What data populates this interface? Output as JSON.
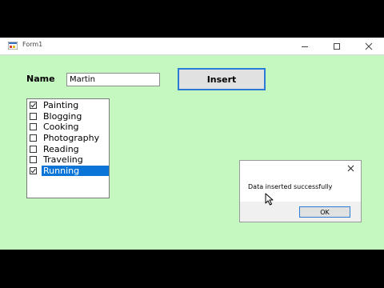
{
  "window": {
    "title": "Form1",
    "background": "#c5f7c0"
  },
  "form": {
    "name_label": "Name",
    "name_value": "Martin",
    "insert_label": "Insert"
  },
  "hobbies": [
    {
      "label": "Painting",
      "checked": true,
      "selected": false
    },
    {
      "label": "Blogging",
      "checked": false,
      "selected": false
    },
    {
      "label": "Cooking",
      "checked": false,
      "selected": false
    },
    {
      "label": "Photography",
      "checked": false,
      "selected": false
    },
    {
      "label": "Reading",
      "checked": false,
      "selected": false
    },
    {
      "label": "Traveling",
      "checked": false,
      "selected": false
    },
    {
      "label": "Running",
      "checked": true,
      "selected": true
    }
  ],
  "message_box": {
    "text": "Data inserted successfully",
    "ok_label": "OK"
  },
  "colors": {
    "accent": "#0a74d9",
    "button_border": "#2a7bd3",
    "button_bg": "#e1e1e1"
  }
}
